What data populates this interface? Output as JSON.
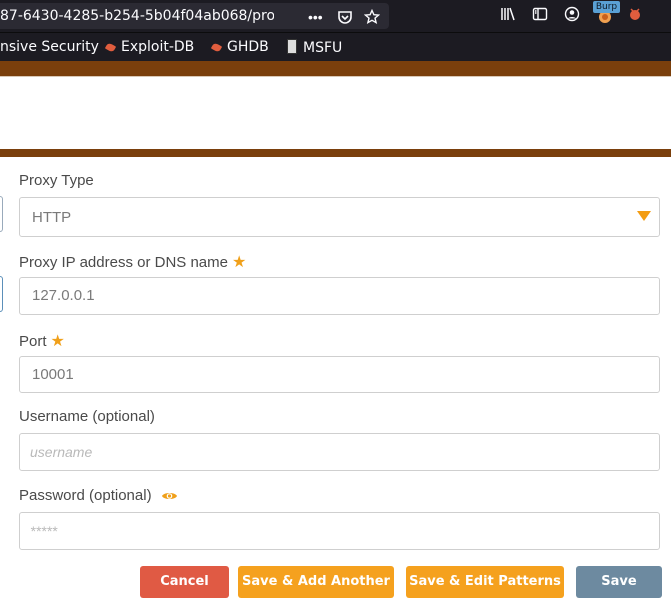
{
  "browser": {
    "url": "87-6430-4285-b254-5b04f04ab068/pro",
    "toolbar_icons": [
      "more-actions-icon",
      "pocket-icon",
      "bookmark-star-icon",
      "library-icon",
      "sidebar-icon",
      "account-icon",
      "burp-extension-icon",
      "extension-icon"
    ],
    "burp_badge": "Burp",
    "bookmarks": [
      {
        "label": "nsive Security"
      },
      {
        "label": "Exploit-DB"
      },
      {
        "label": "GHDB"
      },
      {
        "label": "MSFU"
      }
    ]
  },
  "form": {
    "proxy_type": {
      "label": "Proxy Type",
      "value": "HTTP"
    },
    "proxy_ip": {
      "label": "Proxy IP address or DNS name",
      "value": "127.0.0.1"
    },
    "port": {
      "label": "Port",
      "value": "10001"
    },
    "username": {
      "label": "Username (optional)",
      "placeholder": "username"
    },
    "password": {
      "label": "Password (optional)",
      "placeholder": "*****"
    }
  },
  "buttons": {
    "cancel": "Cancel",
    "save_add": "Save & Add Another",
    "save_edit": "Save & Edit Patterns",
    "save": "Save"
  },
  "colors": {
    "accent_orange": "#f5a11e",
    "cancel_red": "#e05a44",
    "save_blue": "#6d8aa0",
    "header_brown": "#7a3f0c"
  }
}
